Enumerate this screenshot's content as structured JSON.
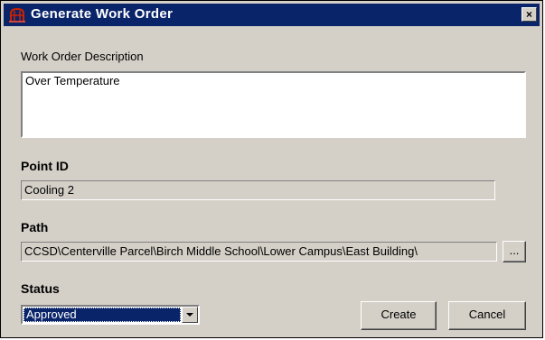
{
  "window": {
    "title": "Generate Work Order",
    "close_label": "×"
  },
  "description": {
    "label": "Work Order Description",
    "value": "Over Temperature"
  },
  "point": {
    "label": "Point ID",
    "value": "Cooling 2"
  },
  "path": {
    "label": "Path",
    "value": "CCSD\\Centerville Parcel\\Birch Middle School\\Lower Campus\\East Building\\",
    "browse_label": "..."
  },
  "status": {
    "label": "Status",
    "selected": "Approved"
  },
  "buttons": {
    "create": "Create",
    "cancel": "Cancel"
  },
  "colors": {
    "titlebar": "#0a246a",
    "dialog_face": "#d4d0c8",
    "selection": "#0a246a",
    "icon": "#cc2200"
  },
  "icons": {
    "app": "generate-work-order-icon",
    "close": "close-icon",
    "dropdown": "dropdown-arrow-icon"
  }
}
